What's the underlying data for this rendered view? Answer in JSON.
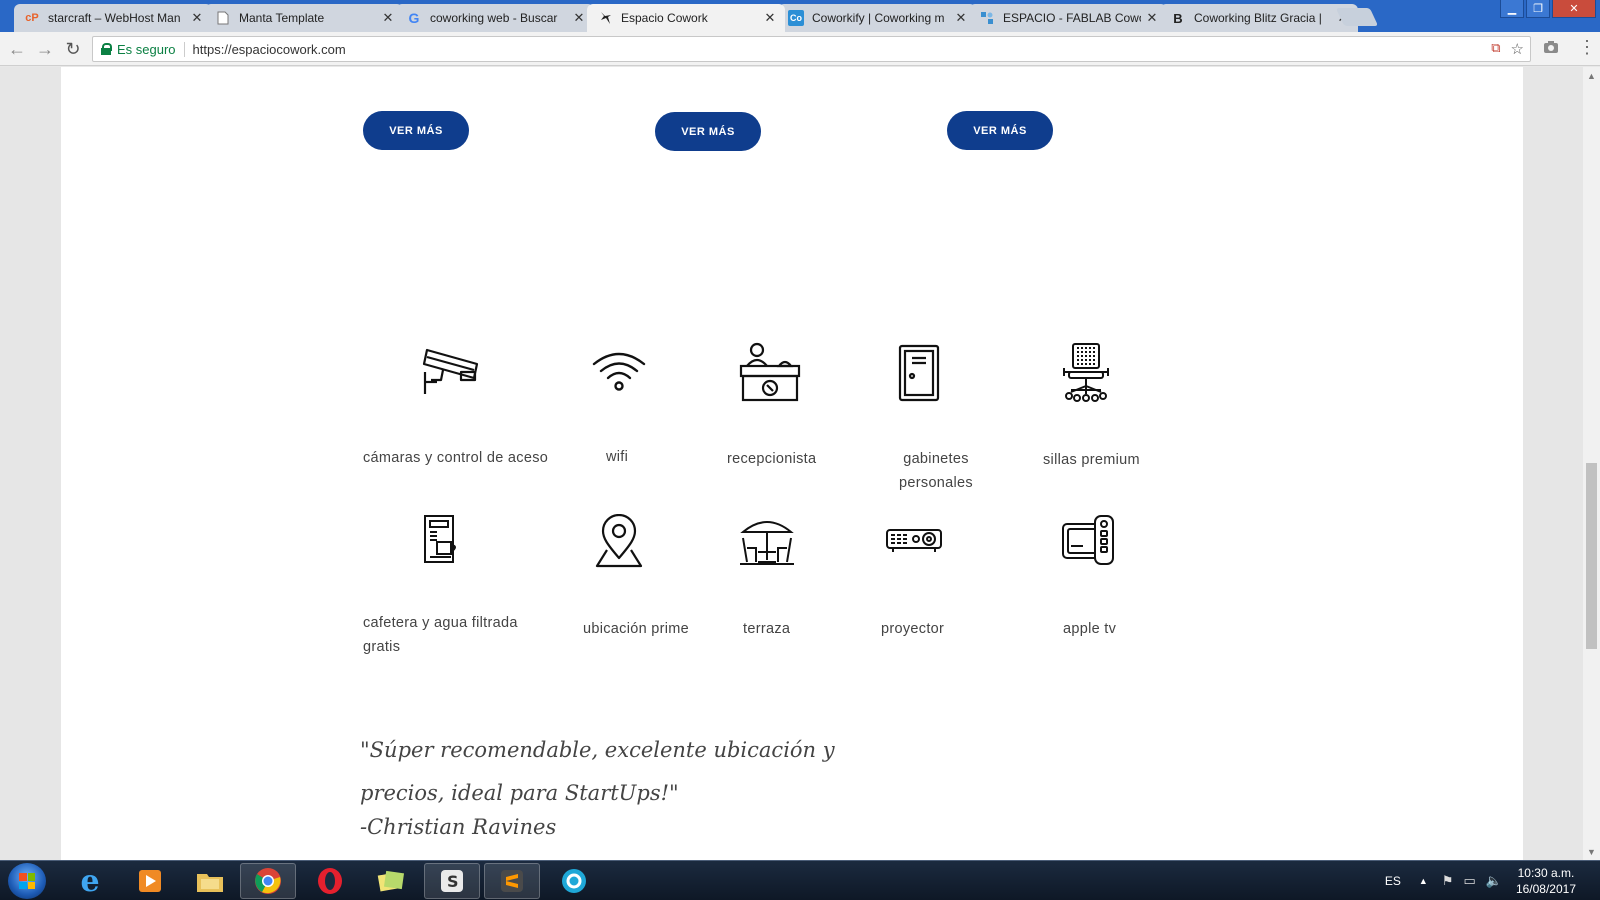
{
  "browser": {
    "tabs": [
      {
        "title": "starcraft – WebHost Man",
        "icon": "cpanel-icon",
        "active": false
      },
      {
        "title": "Manta Template",
        "icon": "document-icon",
        "active": false
      },
      {
        "title": "coworking web - Buscar",
        "icon": "google-icon",
        "active": false
      },
      {
        "title": "Espacio Cowork",
        "icon": "espacio-cowork-icon",
        "active": true
      },
      {
        "title": "Coworkify | Coworking m",
        "icon": "coworkify-icon",
        "active": false
      },
      {
        "title": "ESPACIO - FABLAB Cowo",
        "icon": "fablab-icon",
        "active": false
      },
      {
        "title": "Coworking Blitz Gracia | ",
        "icon": "blitz-icon",
        "active": false
      }
    ],
    "secure_label": "Es seguro",
    "url": "https://espaciocowork.com"
  },
  "page": {
    "ver_mas_buttons": [
      "VER MÁS",
      "VER MÁS",
      "VER MÁS"
    ],
    "features": [
      {
        "label": "cámaras y control de aceso",
        "icon": "security-camera-icon"
      },
      {
        "label": "wifi",
        "icon": "wifi-icon"
      },
      {
        "label": "recepcionista",
        "icon": "reception-desk-icon"
      },
      {
        "label": "gabinetes personales",
        "icon": "locker-icon"
      },
      {
        "label": "sillas premium",
        "icon": "office-chair-icon"
      },
      {
        "label": "cafetera y agua filtrada gratis",
        "icon": "coffee-maker-icon"
      },
      {
        "label": "ubicación prime",
        "icon": "map-pin-icon"
      },
      {
        "label": "terraza",
        "icon": "terrace-table-icon"
      },
      {
        "label": "proyector",
        "icon": "projector-icon"
      },
      {
        "label": "apple tv",
        "icon": "apple-tv-icon"
      }
    ],
    "testimonial": {
      "quote": "\"Súper recomendable, excelente ubicación y precios, ideal para StartUps!\"",
      "author": "-Christian Ravines"
    }
  },
  "taskbar": {
    "language": "ES",
    "time": "10:30 a.m.",
    "date": "16/08/2017"
  },
  "colors": {
    "button_blue": "#0f3d8d",
    "chrome_frame": "#2a68c6"
  }
}
